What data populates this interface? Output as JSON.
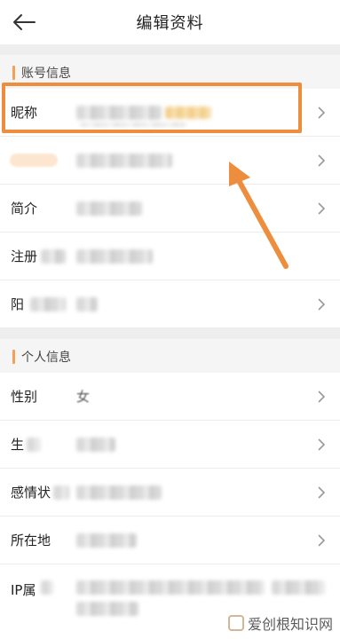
{
  "header": {
    "title": "编辑资料",
    "back_icon": "arrow-left-icon"
  },
  "sections": {
    "account": {
      "title": "账号信息",
      "rows": {
        "nickname": "昵称",
        "badge": "",
        "intro": "简介",
        "register": "注册",
        "sunshine": "阳"
      }
    },
    "personal": {
      "title": "个人信息",
      "rows": {
        "gender": "性别",
        "gender_value": "女",
        "birthday": "生",
        "relationship": "感情状",
        "location": "所在地",
        "ip": "IP属"
      }
    }
  },
  "annotation": {
    "box_color": "#ec8e3d",
    "arrow_color": "#ec8e3d"
  },
  "watermark": {
    "text": "爱创根知识网"
  },
  "colors": {
    "accent": "#f2a15b",
    "section_bg": "#f5f5f5",
    "divider": "#ececec"
  }
}
